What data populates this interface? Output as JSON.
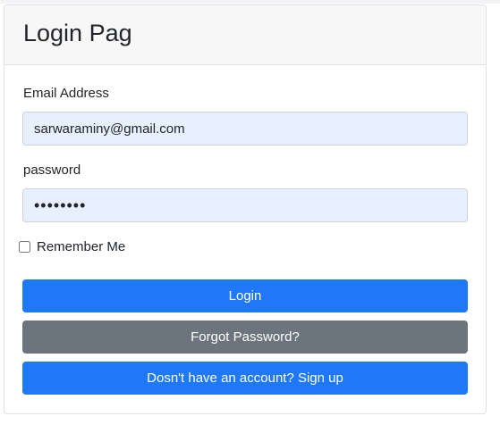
{
  "card": {
    "title": "Login Pag"
  },
  "form": {
    "email_label": "Email Address",
    "email_value": "sarwaraminy@gmail.com",
    "password_label": "password",
    "password_value": "••••••••",
    "remember_label": "Remember Me",
    "remember_checked": false
  },
  "buttons": {
    "login": "Login",
    "forgot": "Forgot Password?",
    "signup": "Dosn't have an account? Sign up"
  },
  "colors": {
    "primary": "#1f78f5",
    "secondary": "#6c757d",
    "autofill_bg": "#e8f0fe"
  }
}
